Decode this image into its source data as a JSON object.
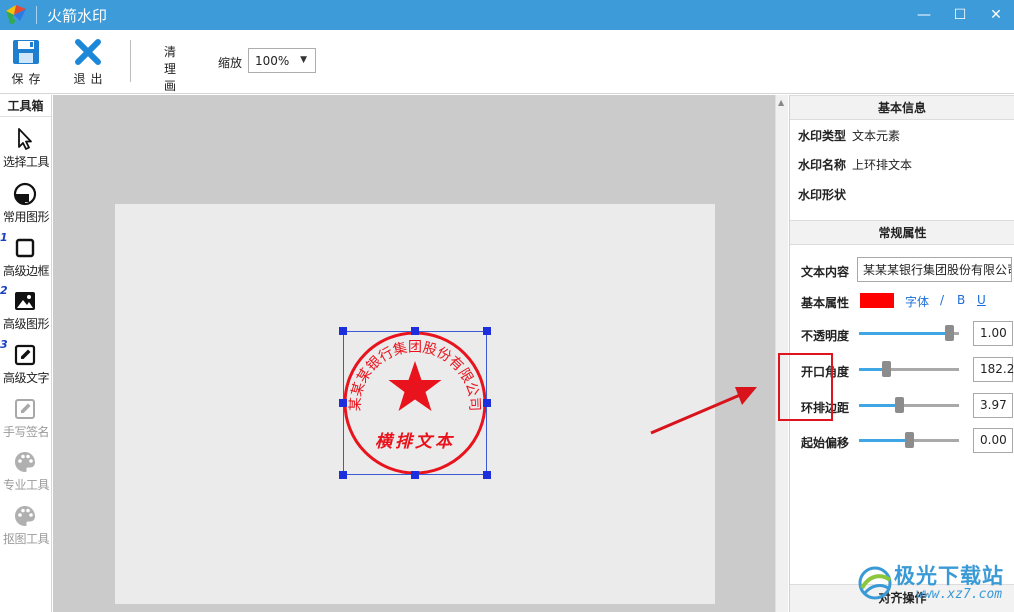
{
  "window": {
    "title": "火箭水印",
    "minimize": "—",
    "maximize": "☐",
    "close": "✕"
  },
  "toolbar": {
    "save_label": "保存",
    "exit_label": "退出",
    "clear_line1": "清理",
    "clear_line2": "画布",
    "zoom_label": "缩放",
    "zoom_value": "100%"
  },
  "toolbox": {
    "title": "工具箱",
    "tools": [
      {
        "label": "选择工具",
        "icon": "cursor-icon",
        "enabled": true
      },
      {
        "label": "常用图形",
        "icon": "shape-icon",
        "enabled": true
      },
      {
        "label": "高级边框",
        "icon": "square-frame-icon",
        "number": "1",
        "enabled": true
      },
      {
        "label": "高级图形",
        "icon": "image-icon",
        "number": "2",
        "enabled": true
      },
      {
        "label": "高级文字",
        "icon": "edit-text-icon",
        "number": "3",
        "enabled": true
      },
      {
        "label": "手写签名",
        "icon": "signature-icon",
        "enabled": false
      },
      {
        "label": "专业工具",
        "icon": "palette-icon",
        "enabled": false
      },
      {
        "label": "抠图工具",
        "icon": "palette-icon",
        "enabled": false
      }
    ]
  },
  "stamp": {
    "ring_text": "某某某银行集团股份有限公司",
    "center_text": "横排文本",
    "color": "#e8131c"
  },
  "panel": {
    "basic_info_header": "基本信息",
    "info": [
      {
        "key": "水印类型",
        "value": "文本元素"
      },
      {
        "key": "水印名称",
        "value": "上环排文本"
      },
      {
        "key": "水印形状",
        "value": ""
      }
    ],
    "props_header": "常规属性",
    "text_content_label": "文本内容",
    "text_content_value": "某某某银行集团股份有限公司",
    "basic_attr_label": "基本属性",
    "text_color": "#ff0000",
    "font_link": "字体",
    "italic_link": "/",
    "bold_link": "B",
    "underline_link": "U",
    "sliders": [
      {
        "label": "不透明度",
        "value": "1.00",
        "level": 0.95
      },
      {
        "label": "开口角度",
        "value": "182.2",
        "level": 0.25
      },
      {
        "label": "环排边距",
        "value": "3.97",
        "level": 0.4
      },
      {
        "label": "起始偏移",
        "value": "0.00",
        "level": 0.5
      }
    ],
    "align_header": "对齐操作"
  },
  "site_watermark": {
    "title": "极光下载站",
    "url": "www.xz7.com"
  }
}
